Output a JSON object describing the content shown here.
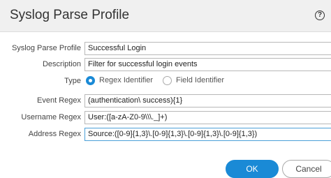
{
  "dialog": {
    "title": "Syslog Parse Profile",
    "help_symbol": "?"
  },
  "form": {
    "profile": {
      "label": "Syslog Parse Profile",
      "value": "Successful Login"
    },
    "description": {
      "label": "Description",
      "value": "Filter for successful login events"
    },
    "type": {
      "label": "Type",
      "options": [
        {
          "label": "Regex Identifier",
          "checked": true
        },
        {
          "label": "Field Identifier",
          "checked": false
        }
      ]
    },
    "event_regex": {
      "label": "Event Regex",
      "value": "(authentication\\ success){1}"
    },
    "username_regex": {
      "label": "Username Regex",
      "value": "User:([a-zA-Z0-9\\\\\\._]+)"
    },
    "address_regex": {
      "label": "Address Regex",
      "value": "Source:([0-9]{1,3}\\.[0-9]{1,3}\\.[0-9]{1,3}\\.[0-9]{1,3})"
    }
  },
  "buttons": {
    "ok": "OK",
    "cancel": "Cancel"
  },
  "colors": {
    "accent": "#1a8ad6",
    "titlebar": "#f0f0f0",
    "focus_border": "#4b9fd8"
  }
}
